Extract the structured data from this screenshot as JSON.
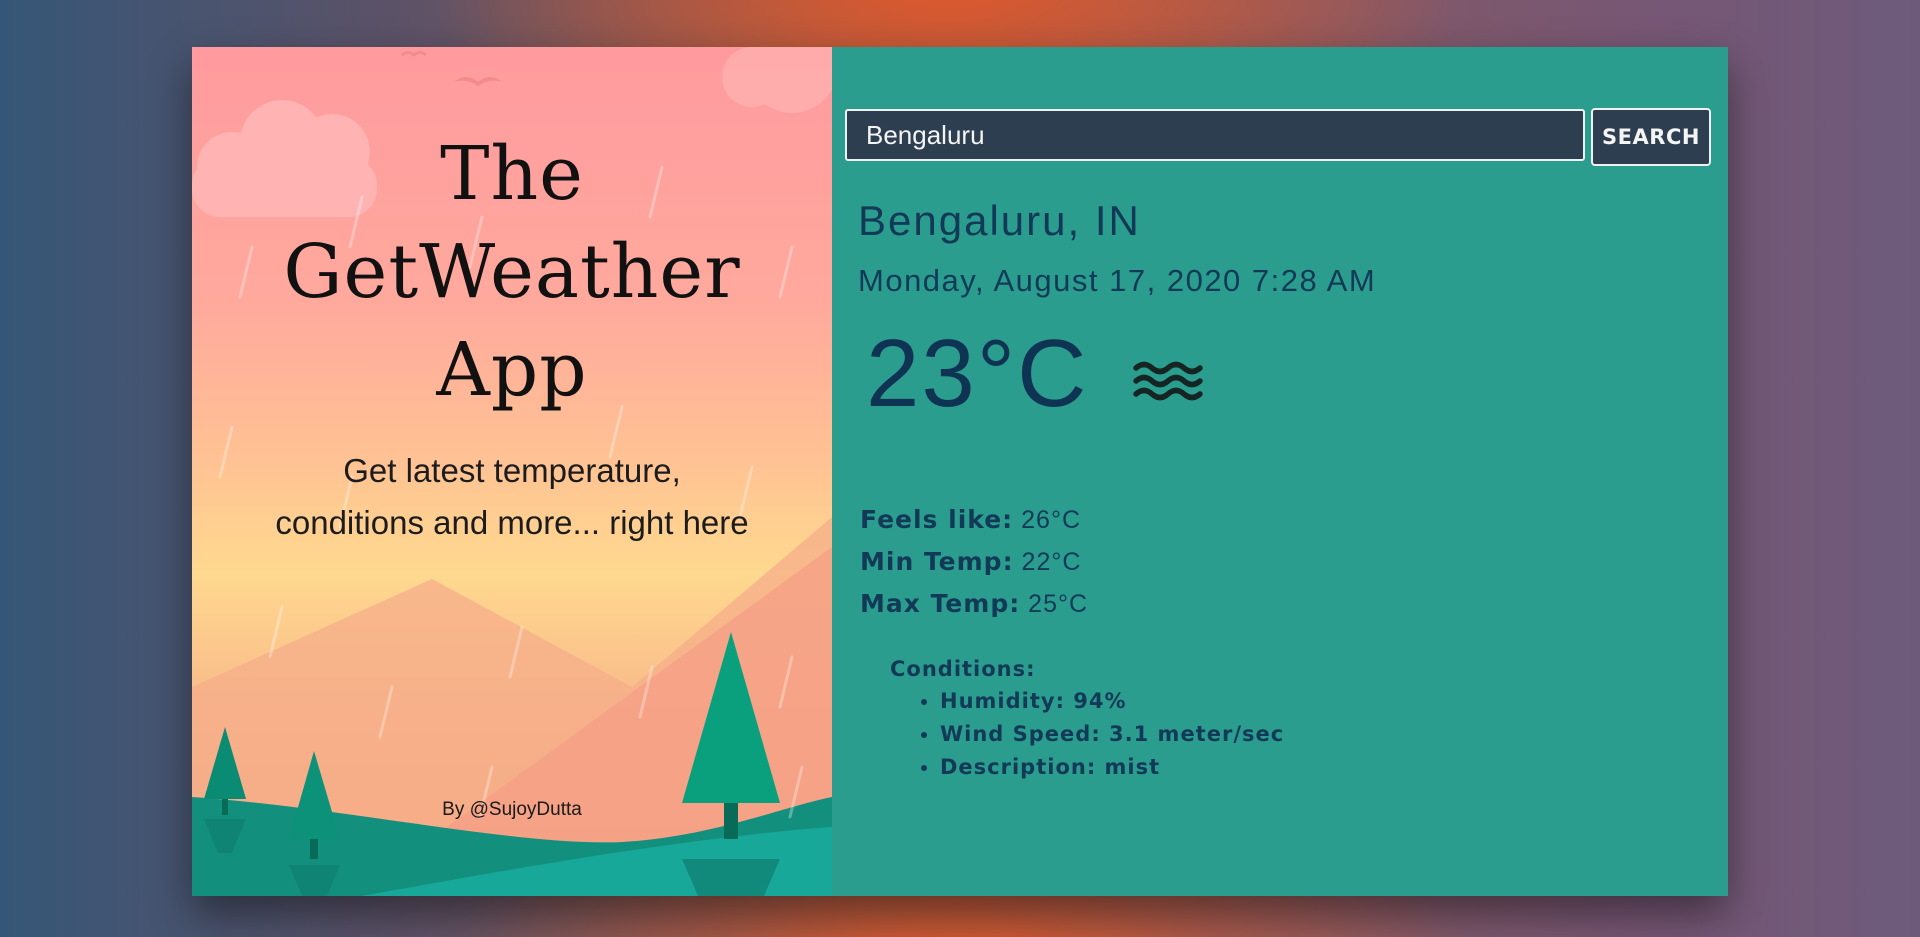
{
  "hero": {
    "title_lines": [
      "The",
      "GetWeather",
      "App"
    ],
    "subtitle_lines": [
      "Get latest temperature,",
      "conditions and more... right here"
    ],
    "credit": "By @SujoyDutta"
  },
  "search": {
    "value": "Bengaluru",
    "button_label": "SEARCH"
  },
  "weather": {
    "location": "Bengaluru, IN",
    "datetime": "Monday, August 17, 2020 7:28 AM",
    "temperature": "23°C",
    "icon": "mist-icon",
    "stats": [
      {
        "label": "Feels like:",
        "value": "26°C"
      },
      {
        "label": "Min Temp:",
        "value": "22°C"
      },
      {
        "label": "Max Temp:",
        "value": "25°C"
      }
    ],
    "conditions_label": "Conditions:",
    "conditions": [
      {
        "label": "Humidity:",
        "value": "94%"
      },
      {
        "label": "Wind Speed:",
        "value": "3.1 meter/sec"
      },
      {
        "label": "Description:",
        "value": "mist"
      }
    ]
  },
  "colors": {
    "panel_bg": "#2a9d8f",
    "input_bg": "#2c3e50",
    "text_dark": "#123a57"
  }
}
